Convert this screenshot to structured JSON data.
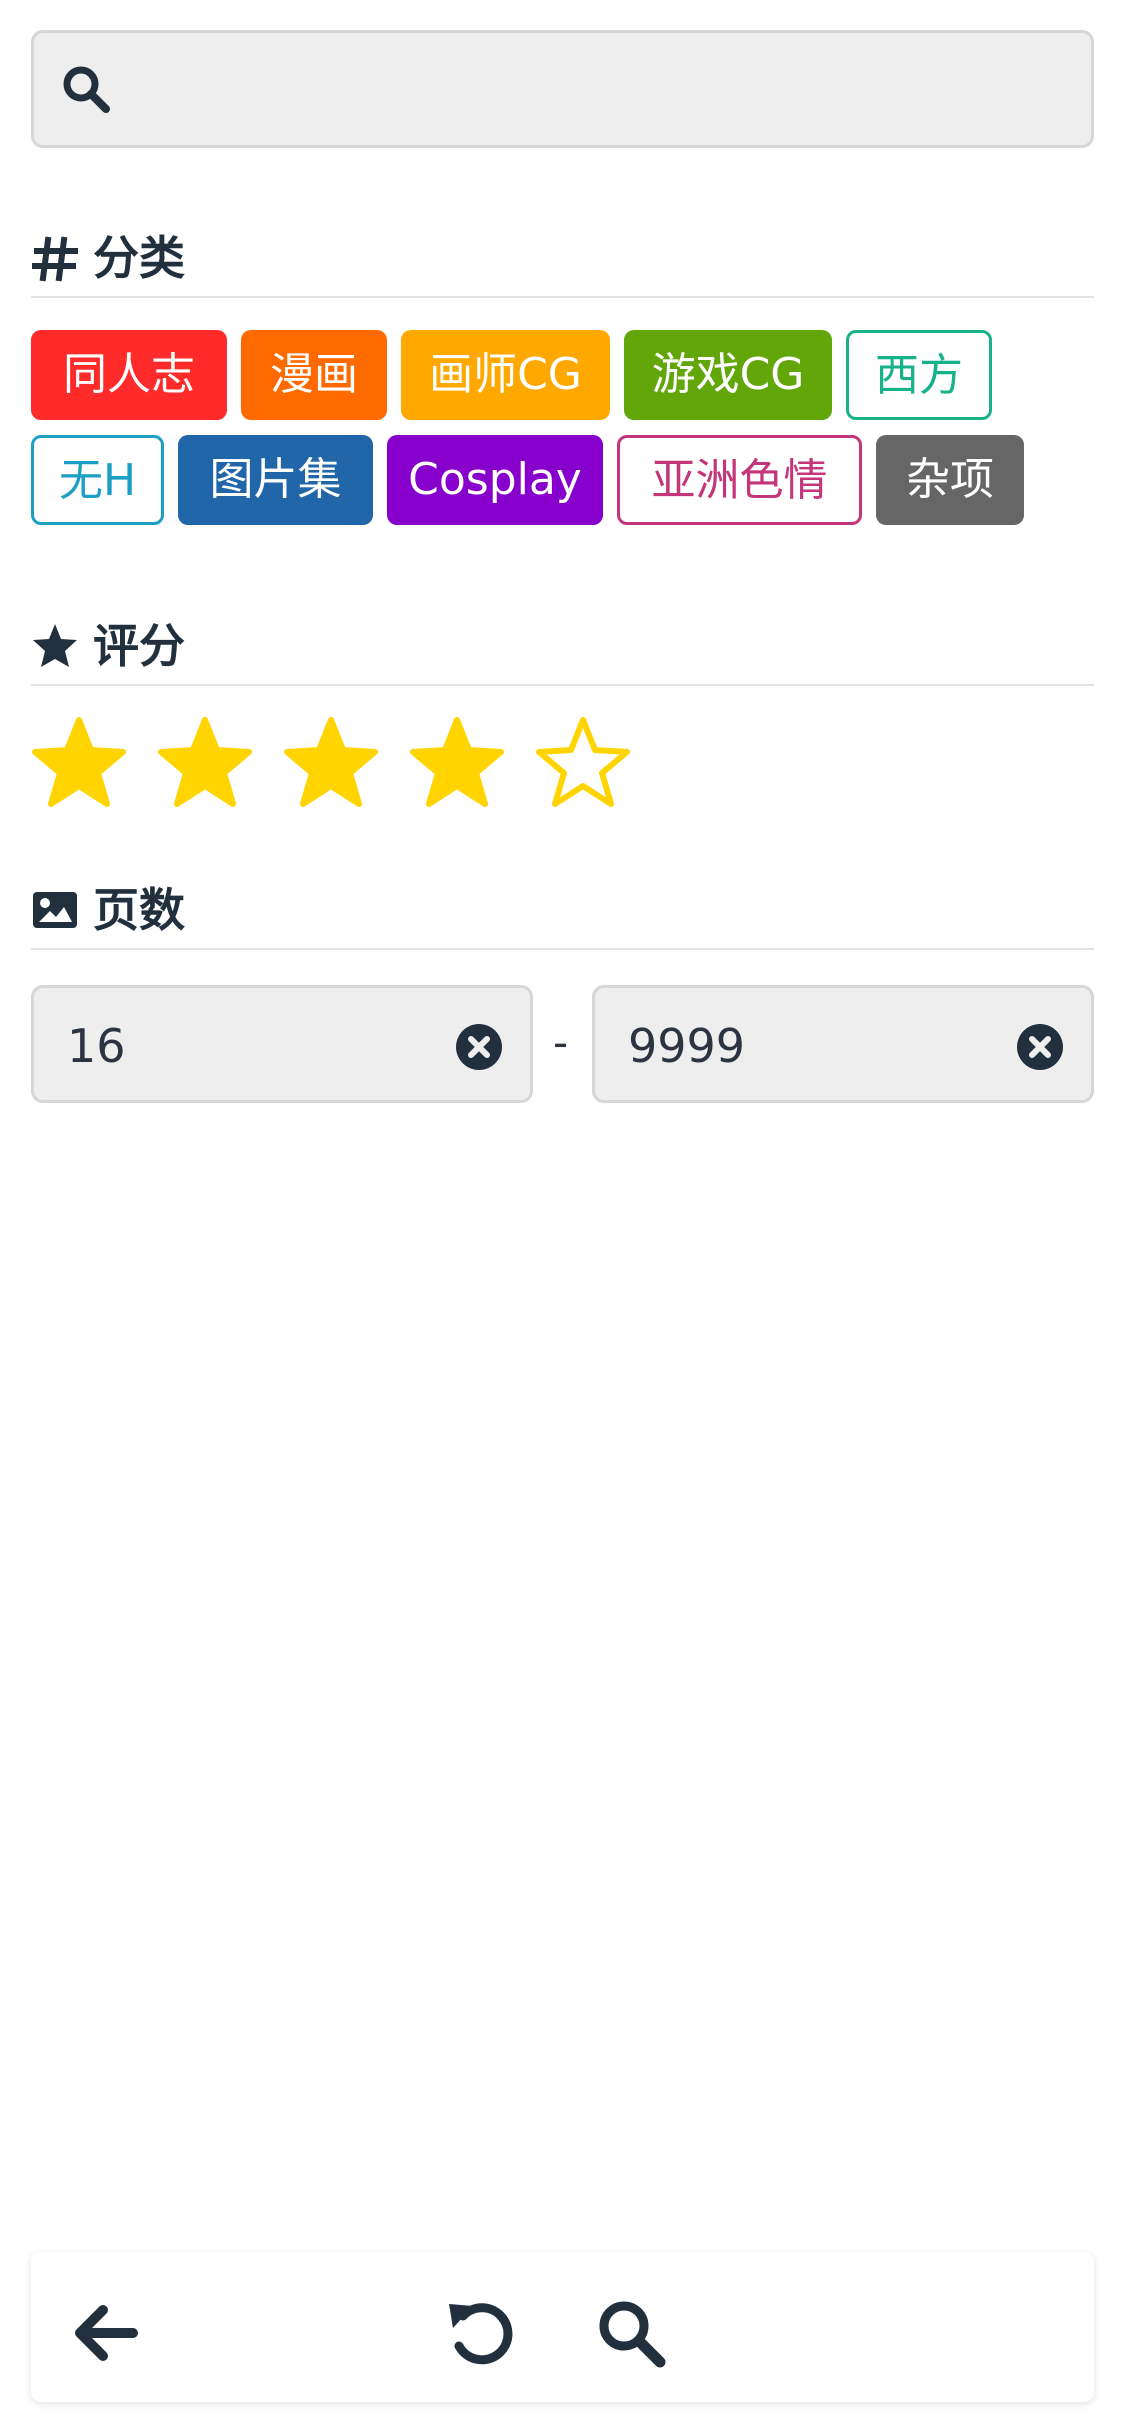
{
  "search": {
    "placeholder": "",
    "value": ""
  },
  "sections": {
    "category": {
      "title": "分类",
      "icon": "hash-icon"
    },
    "rating": {
      "title": "评分",
      "icon": "star-icon"
    },
    "pages": {
      "title": "页数",
      "icon": "image-icon"
    }
  },
  "categories": [
    {
      "label": "同人志",
      "color": "#ff2a2a",
      "style": "solid",
      "selected": true
    },
    {
      "label": "漫画",
      "color": "#ff6a00",
      "style": "solid",
      "selected": true
    },
    {
      "label": "画师CG",
      "color": "#ffa800",
      "style": "solid",
      "selected": true
    },
    {
      "label": "游戏CG",
      "color": "#62a60a",
      "style": "solid",
      "selected": true
    },
    {
      "label": "西方",
      "color": "#17b28a",
      "style": "outline",
      "selected": false
    },
    {
      "label": "无H",
      "color": "#1c9fc4",
      "style": "outline",
      "selected": false
    },
    {
      "label": "图片集",
      "color": "#2266aa",
      "style": "solid",
      "selected": true
    },
    {
      "label": "Cosplay",
      "color": "#8800cc",
      "style": "solid",
      "selected": true
    },
    {
      "label": "亚洲色情",
      "color": "#c4357a",
      "style": "outline",
      "selected": false
    },
    {
      "label": "杂项",
      "color": "#666666",
      "style": "solid",
      "selected": true
    }
  ],
  "rating": {
    "value": 4,
    "max": 5,
    "color": "#ffd400"
  },
  "pages": {
    "min": "16",
    "max": "9999",
    "separator": "-"
  },
  "toolbar": {
    "back_icon": "arrow-left-icon",
    "reset_icon": "undo-icon",
    "search_icon": "search-icon"
  },
  "colors": {
    "text": "#22303e",
    "field_bg": "#eeeeee"
  }
}
